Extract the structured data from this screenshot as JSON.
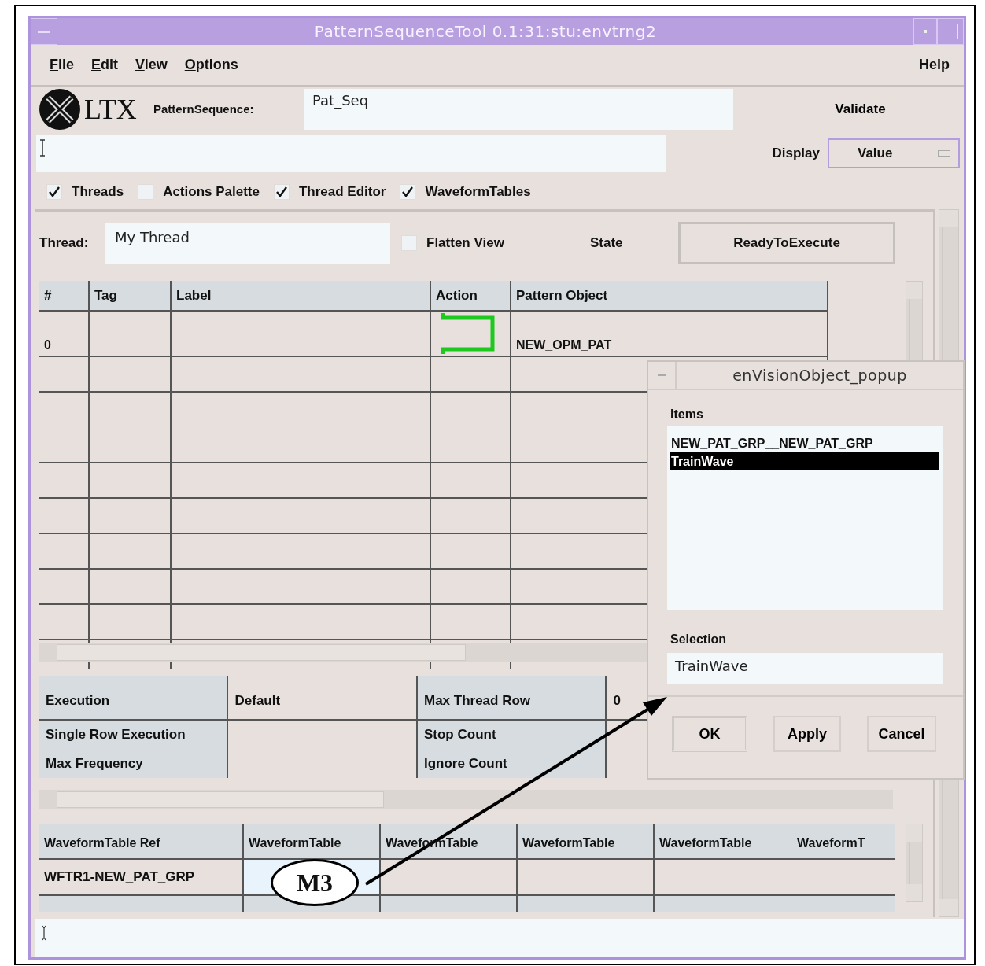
{
  "window": {
    "title": "PatternSequenceTool 0.1:31:stu:envtrng2"
  },
  "menus": [
    {
      "label": "File",
      "kind": "menu"
    },
    {
      "label": "Edit",
      "kind": "menu"
    },
    {
      "label": "View",
      "kind": "menu"
    },
    {
      "label": "Options",
      "kind": "menu"
    },
    {
      "label": "Help",
      "kind": "help"
    }
  ],
  "logo": {
    "text": "LTX"
  },
  "pattern_sequence": {
    "label": "PatternSequence:",
    "value": "Pat_Seq"
  },
  "validate_button": "Validate",
  "display": {
    "label": "Display",
    "value": "Value"
  },
  "panels": [
    {
      "label": "Threads",
      "checked": true
    },
    {
      "label": "Actions Palette",
      "checked": false
    },
    {
      "label": "Thread Editor",
      "checked": true
    },
    {
      "label": "WaveformTables",
      "checked": true
    }
  ],
  "thread": {
    "label": "Thread:",
    "value": "My Thread",
    "flatten": {
      "label": "Flatten View",
      "checked": false
    },
    "state_label": "State",
    "state": "ReadyToExecute"
  },
  "thread_table": {
    "columns": [
      "#",
      "Tag",
      "Label",
      "Action",
      "Pattern Object"
    ],
    "rows": [
      {
        "number": "0",
        "kind": "bracket",
        "pattern_object": "NEW_OPM_PAT"
      }
    ]
  },
  "execution_table": {
    "rows": [
      {
        "cells": [
          "Execution",
          "Default",
          "Max Thread Row",
          "0"
        ]
      },
      {
        "cells": [
          "Single Row Execution",
          null,
          "Stop Count",
          null
        ]
      },
      {
        "cells": [
          "Max Frequency",
          null,
          "Ignore Count",
          null
        ]
      }
    ]
  },
  "waveform_table": {
    "columns": [
      "WaveformTable Ref",
      "WaveformTable",
      "WaveformTable",
      "WaveformTable",
      "WaveformTable",
      "WaveformT"
    ],
    "rows": [
      {
        "cells": [
          {
            "text": "WFTR1-NEW_PAT_GRP",
            "selected": false
          },
          {
            "selected": true
          },
          {
            "selected": false
          },
          {
            "selected": false
          },
          {
            "selected": false
          },
          {
            "selected": false
          }
        ]
      }
    ]
  },
  "popup": {
    "title": "enVisionObject_popup",
    "items_label": "Items",
    "items": [
      {
        "label": "NEW_PAT_GRP__NEW_PAT_GRP",
        "selected": false
      },
      {
        "label": "TrainWave",
        "selected": true
      }
    ],
    "selection_label": "Selection",
    "selection_value": "TrainWave",
    "buttons": [
      {
        "label": "OK",
        "default": true
      },
      {
        "label": "Apply",
        "default": false
      },
      {
        "label": "Cancel",
        "default": false
      }
    ]
  },
  "callout": {
    "label": "M3"
  }
}
